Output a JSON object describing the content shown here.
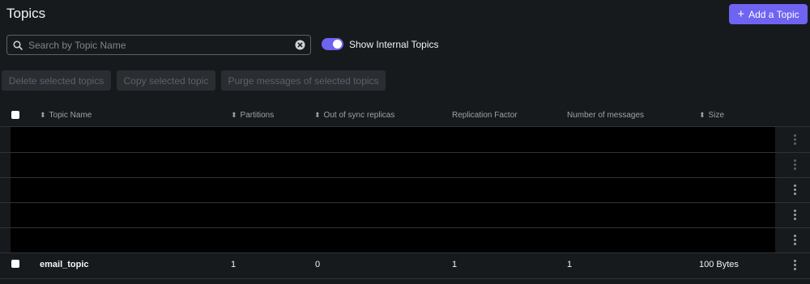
{
  "header": {
    "title": "Topics",
    "add_button_label": "Add a Topic"
  },
  "search": {
    "placeholder": "Search by Topic Name",
    "value": ""
  },
  "toggle": {
    "label": "Show Internal Topics",
    "checked": true
  },
  "bulk_actions": [
    "Delete selected topics",
    "Copy selected topic",
    "Purge messages of selected topics"
  ],
  "table": {
    "columns": [
      "Topic Name",
      "Partitions",
      "Out of sync replicas",
      "Replication Factor",
      "Number of messages",
      "Size"
    ],
    "rows": [
      {
        "name": "email_topic",
        "partitions": "1",
        "out_of_sync": "0",
        "replication": "1",
        "messages": "1",
        "size": "100 Bytes"
      }
    ]
  },
  "colors": {
    "accent": "#6f63f2",
    "background": "#171a1c",
    "redacted": "#000000"
  }
}
